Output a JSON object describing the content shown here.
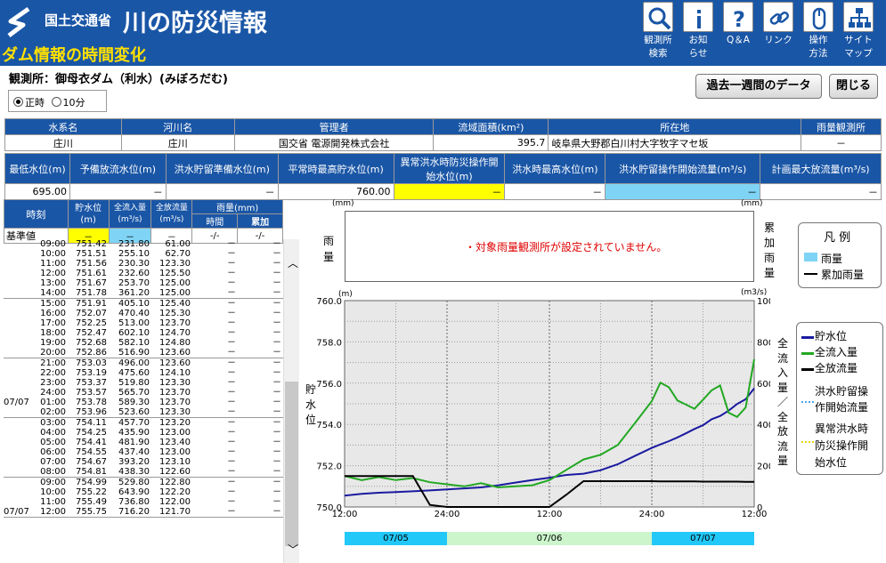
{
  "header": {
    "org": "国土交通省",
    "app_title": "川の防災情報",
    "subtitle": "ダム情報の時間変化",
    "nav": [
      {
        "label1": "観測所",
        "label2": "検索",
        "icon": "search-icon"
      },
      {
        "label1": "お知",
        "label2": "らせ",
        "icon": "info-icon"
      },
      {
        "label1": "Q＆A",
        "label2": "",
        "icon": "question-icon"
      },
      {
        "label1": "リンク",
        "label2": "",
        "icon": "link-icon"
      },
      {
        "label1": "操作",
        "label2": "方法",
        "icon": "mouse-icon"
      },
      {
        "label1": "サイト",
        "label2": "マップ",
        "icon": "sitemap-icon"
      }
    ]
  },
  "station": "観測所：御母衣ダム（利水）(みぼろだむ)",
  "buttons": {
    "week": "過去一週間のデータ",
    "close": "閉じる"
  },
  "radio": {
    "opt1": "正時",
    "opt2": "10分"
  },
  "info1": {
    "headers": [
      "水系名",
      "河川名",
      "管理者",
      "流域面積(km²)",
      "所在地",
      "雨量観測所"
    ],
    "values": [
      "庄川",
      "庄川",
      "国交省 電源開発株式会社",
      "395.7",
      "岐阜県大野郡白川村大字牧字マセ坂",
      "－"
    ]
  },
  "info2": {
    "headers": [
      "最低水位(m)",
      "予備放流水位(m)",
      "洪水貯留準備水位(m)",
      "平常時最高貯水位(m)",
      "異常洪水時防災操作開始水位(m)",
      "洪水時最高水位(m)",
      "洪水貯留操作開始流量(m³/s)",
      "計画最大放流量(m³/s)"
    ],
    "values": [
      "695.00",
      "－",
      "－",
      "760.00",
      "－",
      "－",
      "－",
      "－"
    ]
  },
  "table": {
    "h_time": "時刻",
    "h_level": "貯水位",
    "h_level_u": "(m)",
    "h_in": "全流入量",
    "h_in_u": "(m³/s)",
    "h_out": "全放流量",
    "h_out_u": "(m³/s)",
    "h_rain": "雨量(mm)",
    "h_rain_t": "時間",
    "h_rain_c": "累加",
    "base_label": "基準値",
    "base_level": "－",
    "base_in": "－",
    "base_out": "－",
    "base_rt": "-/-",
    "base_rc": "-/-",
    "rows": [
      [
        "",
        "09:00",
        "751.42",
        "231.80",
        "61.00"
      ],
      [
        "",
        "10:00",
        "751.51",
        "255.10",
        "62.70"
      ],
      [
        "",
        "11:00",
        "751.56",
        "230.30",
        "123.30"
      ],
      [
        "",
        "12:00",
        "751.61",
        "232.60",
        "125.50"
      ],
      [
        "",
        "13:00",
        "751.67",
        "253.70",
        "125.00"
      ],
      [
        "",
        "14:00",
        "751.78",
        "361.20",
        "125.00"
      ],
      [
        "",
        "15:00",
        "751.91",
        "405.10",
        "125.40"
      ],
      [
        "",
        "16:00",
        "752.07",
        "470.40",
        "125.30"
      ],
      [
        "",
        "17:00",
        "752.25",
        "513.00",
        "123.70"
      ],
      [
        "",
        "18:00",
        "752.47",
        "602.10",
        "124.70"
      ],
      [
        "",
        "19:00",
        "752.68",
        "582.10",
        "124.80"
      ],
      [
        "",
        "20:00",
        "752.86",
        "516.90",
        "123.60"
      ],
      [
        "",
        "21:00",
        "753.03",
        "496.00",
        "123.60"
      ],
      [
        "",
        "22:00",
        "753.19",
        "475.60",
        "124.10"
      ],
      [
        "",
        "23:00",
        "753.37",
        "519.80",
        "123.30"
      ],
      [
        "",
        "24:00",
        "753.57",
        "565.70",
        "123.70"
      ],
      [
        "07/07",
        "01:00",
        "753.78",
        "589.30",
        "123.70"
      ],
      [
        "",
        "02:00",
        "753.96",
        "523.60",
        "123.30"
      ],
      [
        "",
        "03:00",
        "754.11",
        "457.70",
        "123.20"
      ],
      [
        "",
        "04:00",
        "754.25",
        "435.90",
        "123.00"
      ],
      [
        "",
        "05:00",
        "754.41",
        "481.90",
        "123.40"
      ],
      [
        "",
        "06:00",
        "754.55",
        "437.40",
        "123.00"
      ],
      [
        "",
        "07:00",
        "754.67",
        "393.20",
        "123.10"
      ],
      [
        "",
        "08:00",
        "754.81",
        "438.30",
        "122.60"
      ],
      [
        "",
        "09:00",
        "754.99",
        "529.80",
        "122.80"
      ],
      [
        "",
        "10:00",
        "755.22",
        "643.90",
        "122.20"
      ],
      [
        "",
        "11:00",
        "755.49",
        "736.80",
        "122.00"
      ],
      [
        "07/07",
        "12:00",
        "755.75",
        "716.20",
        "121.70"
      ]
    ],
    "dash": "－"
  },
  "chart_data": [
    {
      "type": "bar",
      "title": "雨量",
      "y2label": "累加雨量",
      "unit_left": "(mm)",
      "unit_right": "(mm)",
      "message": "・対象雨量観測所が設定されていません。",
      "values": []
    },
    {
      "type": "line",
      "ylabel": "貯水位",
      "y2label": "全流入量／全放流量",
      "unit_left": "(m)",
      "unit_right": "(m3/s)",
      "ylim": [
        750,
        760
      ],
      "y2lim": [
        0,
        1000
      ],
      "yticks": [
        "760.0",
        "758.0",
        "756.0",
        "754.0",
        "752.0",
        "750.0"
      ],
      "y2ticks": [
        "1000",
        "800",
        "600",
        "400",
        "200",
        "0"
      ],
      "xticks": [
        "12:00",
        "24:00",
        "12:00",
        "24:00",
        "12:00"
      ],
      "x": [
        0,
        2,
        4,
        6,
        8,
        10,
        12,
        14,
        16,
        18,
        20,
        22,
        24,
        26,
        28,
        30,
        32,
        34,
        36,
        37,
        38,
        39,
        40,
        41,
        42,
        43,
        44,
        45,
        46,
        47,
        48
      ],
      "series": [
        {
          "name": "貯水位",
          "color": "#1a1aa0",
          "axis": "left",
          "values": [
            750.55,
            750.64,
            750.69,
            750.72,
            750.76,
            750.8,
            750.85,
            750.9,
            750.95,
            751.05,
            751.18,
            751.3,
            751.42,
            751.55,
            751.61,
            751.78,
            752.07,
            752.47,
            752.86,
            753.03,
            753.19,
            753.37,
            753.57,
            753.78,
            753.96,
            754.25,
            754.41,
            754.67,
            754.99,
            755.22,
            755.75
          ]
        },
        {
          "name": "全流入量",
          "color": "#22a822",
          "axis": "right",
          "values": [
            150,
            130,
            145,
            130,
            140,
            120,
            110,
            100,
            115,
            95,
            100,
            105,
            130,
            180,
            230,
            253,
            300,
            405,
            513,
            602,
            580,
            516,
            496,
            476,
            520,
            565,
            589,
            457,
            436,
            482,
            716
          ]
        },
        {
          "name": "全放流量",
          "color": "#000000",
          "axis": "right",
          "values": [
            150,
            150,
            150,
            150,
            150,
            10,
            0,
            0,
            0,
            0,
            0,
            0,
            0,
            60,
            125,
            125,
            125,
            125,
            125,
            124,
            124,
            124,
            124,
            124,
            123,
            123,
            123,
            123,
            123,
            122,
            122
          ]
        },
        {
          "name": "洪水貯留操作開始流量",
          "color": "#4aa8e8",
          "axis": "right",
          "values": []
        },
        {
          "name": "異常洪水時防災操作開始水位",
          "color": "#e8d800",
          "axis": "left",
          "values": []
        }
      ],
      "date_bar": [
        "07/05",
        "07/06",
        "07/07"
      ]
    }
  ],
  "legend1": {
    "title": "凡 例",
    "items": [
      "雨量",
      "累加雨量"
    ]
  },
  "legend2": {
    "items": [
      "貯水位",
      "全流入量",
      "全放流量",
      "洪水貯留操",
      "作開始流量",
      "異常洪水時",
      "防災操作開",
      "始水位"
    ]
  },
  "colors": {
    "header_bg": "#1a56a6",
    "subtitle": "#ffe000",
    "highlight": "#ffff00",
    "cyan": "#7fd4f5"
  }
}
